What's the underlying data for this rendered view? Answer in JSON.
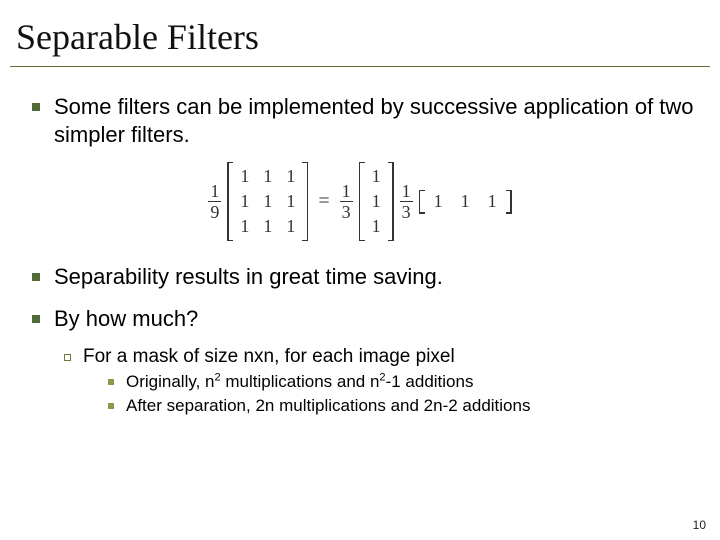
{
  "title": "Separable Filters",
  "bullets": {
    "p1": "Some filters can be implemented by successive application of two simpler filters.",
    "p2": "Separability results in great time saving.",
    "p3": "By how much?",
    "sub1": "For a mask of size nxn, for each image pixel",
    "subsub1_pre": "Originally, n",
    "subsub1_mid": " multiplications and n",
    "subsub1_post": "-1 additions",
    "subsub2": "After separation, 2n multiplications and 2n-2 additions",
    "exp2a": "2",
    "exp2b": "2"
  },
  "equation": {
    "f1n": "1",
    "f1d": "9",
    "m1": [
      "1",
      "1",
      "1",
      "1",
      "1",
      "1",
      "1",
      "1",
      "1"
    ],
    "eq": "=",
    "f2n": "1",
    "f2d": "3",
    "col": [
      "1",
      "1",
      "1"
    ],
    "f3n": "1",
    "f3d": "3",
    "row": [
      "1",
      "1",
      "1"
    ]
  },
  "page_number": "10"
}
